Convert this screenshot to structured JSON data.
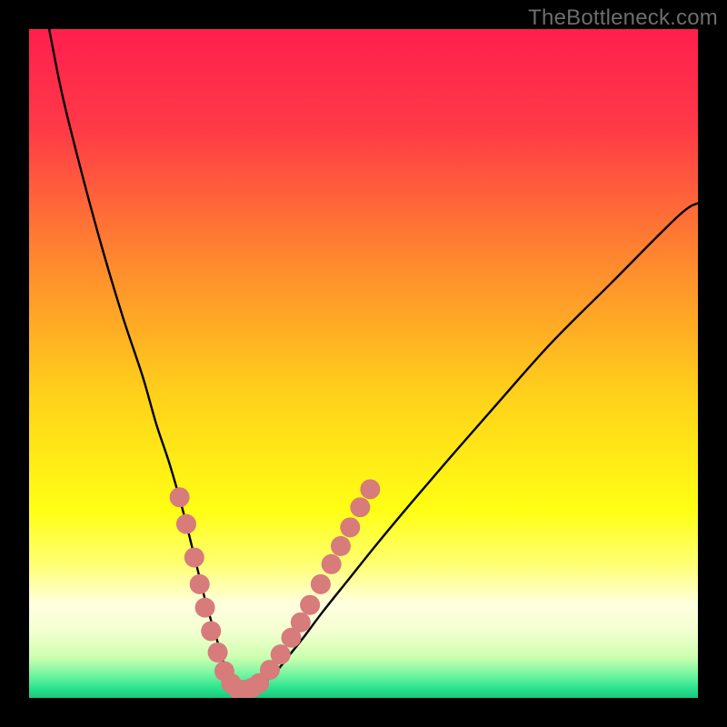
{
  "watermark": "TheBottleneck.com",
  "colors": {
    "frame": "#000000",
    "gradient_stops": [
      {
        "offset": 0.0,
        "color": "#ff1f4e"
      },
      {
        "offset": 0.15,
        "color": "#ff3a47"
      },
      {
        "offset": 0.35,
        "color": "#ff8a2e"
      },
      {
        "offset": 0.55,
        "color": "#ffd21a"
      },
      {
        "offset": 0.72,
        "color": "#ffff14"
      },
      {
        "offset": 0.8,
        "color": "#ffff73"
      },
      {
        "offset": 0.86,
        "color": "#ffffe0"
      },
      {
        "offset": 0.9,
        "color": "#f3ffd0"
      },
      {
        "offset": 0.94,
        "color": "#ccffb0"
      },
      {
        "offset": 0.965,
        "color": "#74f5a0"
      },
      {
        "offset": 0.985,
        "color": "#2de38f"
      },
      {
        "offset": 1.0,
        "color": "#18c87e"
      }
    ],
    "curve": "#000000",
    "markers": "#d77b7b"
  },
  "chart_data": {
    "type": "line",
    "title": "",
    "xlabel": "",
    "ylabel": "",
    "xlim": [
      0,
      100
    ],
    "ylim": [
      0,
      100
    ],
    "grid": false,
    "series": [
      {
        "name": "bottleneck-curve",
        "x": [
          3,
          5,
          8,
          11,
          14,
          17,
          19,
          21,
          23,
          25,
          26.5,
          28,
          29,
          30,
          31,
          32,
          33.5,
          35,
          37,
          39,
          41,
          44,
          48,
          52,
          57,
          63,
          70,
          78,
          87,
          97,
          100
        ],
        "y": [
          100,
          90,
          78,
          67,
          57,
          48,
          41,
          35,
          28,
          20,
          14,
          9,
          5.5,
          3,
          1.5,
          1.2,
          1.5,
          2.2,
          4,
          6.5,
          9,
          13,
          18,
          23,
          29,
          36,
          44,
          53,
          62,
          72,
          74
        ]
      }
    ],
    "markers": {
      "name": "highlight-dots",
      "points": [
        {
          "x": 22.5,
          "y": 30
        },
        {
          "x": 23.5,
          "y": 26
        },
        {
          "x": 24.7,
          "y": 21
        },
        {
          "x": 25.5,
          "y": 17
        },
        {
          "x": 26.3,
          "y": 13.5
        },
        {
          "x": 27.2,
          "y": 10
        },
        {
          "x": 28.2,
          "y": 6.8
        },
        {
          "x": 29.2,
          "y": 4.0
        },
        {
          "x": 30.2,
          "y": 2.2
        },
        {
          "x": 31.2,
          "y": 1.3
        },
        {
          "x": 32.2,
          "y": 1.2
        },
        {
          "x": 33.3,
          "y": 1.5
        },
        {
          "x": 34.4,
          "y": 2.2
        },
        {
          "x": 36.0,
          "y": 4.2
        },
        {
          "x": 37.6,
          "y": 6.5
        },
        {
          "x": 39.2,
          "y": 9.0
        },
        {
          "x": 40.6,
          "y": 11.3
        },
        {
          "x": 42.0,
          "y": 13.9
        },
        {
          "x": 43.6,
          "y": 17.0
        },
        {
          "x": 45.2,
          "y": 20.0
        },
        {
          "x": 46.6,
          "y": 22.7
        },
        {
          "x": 48.0,
          "y": 25.5
        },
        {
          "x": 49.5,
          "y": 28.5
        },
        {
          "x": 51.0,
          "y": 31.2
        }
      ]
    }
  }
}
